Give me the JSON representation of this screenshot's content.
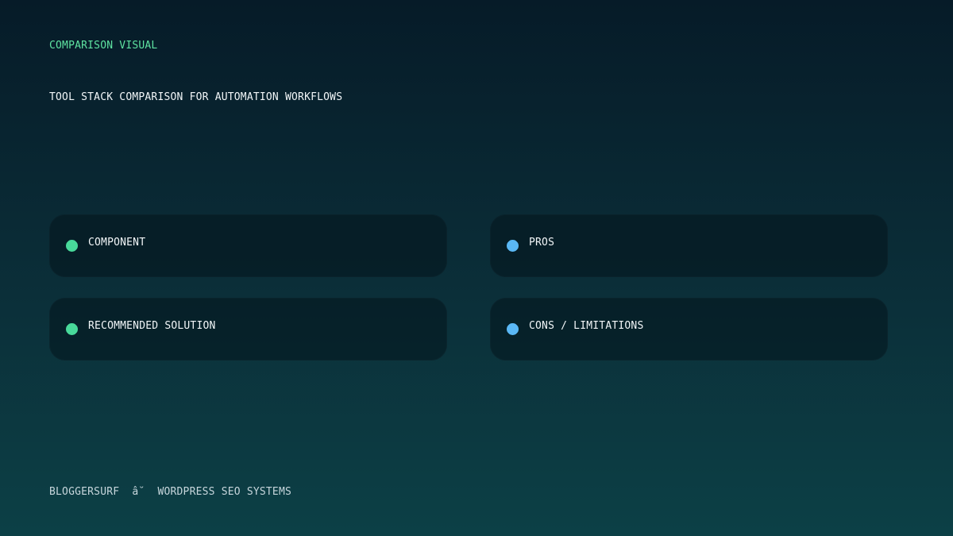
{
  "header": {
    "kicker": "COMPARISON VISUAL",
    "title": "TOOL STACK COMPARISON FOR AUTOMATION WORKFLOWS"
  },
  "cards": [
    {
      "label": "COMPONENT",
      "dot_color": "#48d99a"
    },
    {
      "label": "PROS",
      "dot_color": "#5ab8f5"
    },
    {
      "label": "RECOMMENDED SOLUTION",
      "dot_color": "#48d99a"
    },
    {
      "label": "CONS / LIMITATIONS",
      "dot_color": "#5ab8f5"
    }
  ],
  "footer": {
    "text": "BLOGGERSURF  â˘  WORDPRESS SEO SYSTEMS"
  },
  "colors": {
    "accent_green": "#5ee3a1",
    "accent_blue": "#5ab8f5",
    "background_top": "#061b28",
    "background_bottom": "#0c4046"
  }
}
